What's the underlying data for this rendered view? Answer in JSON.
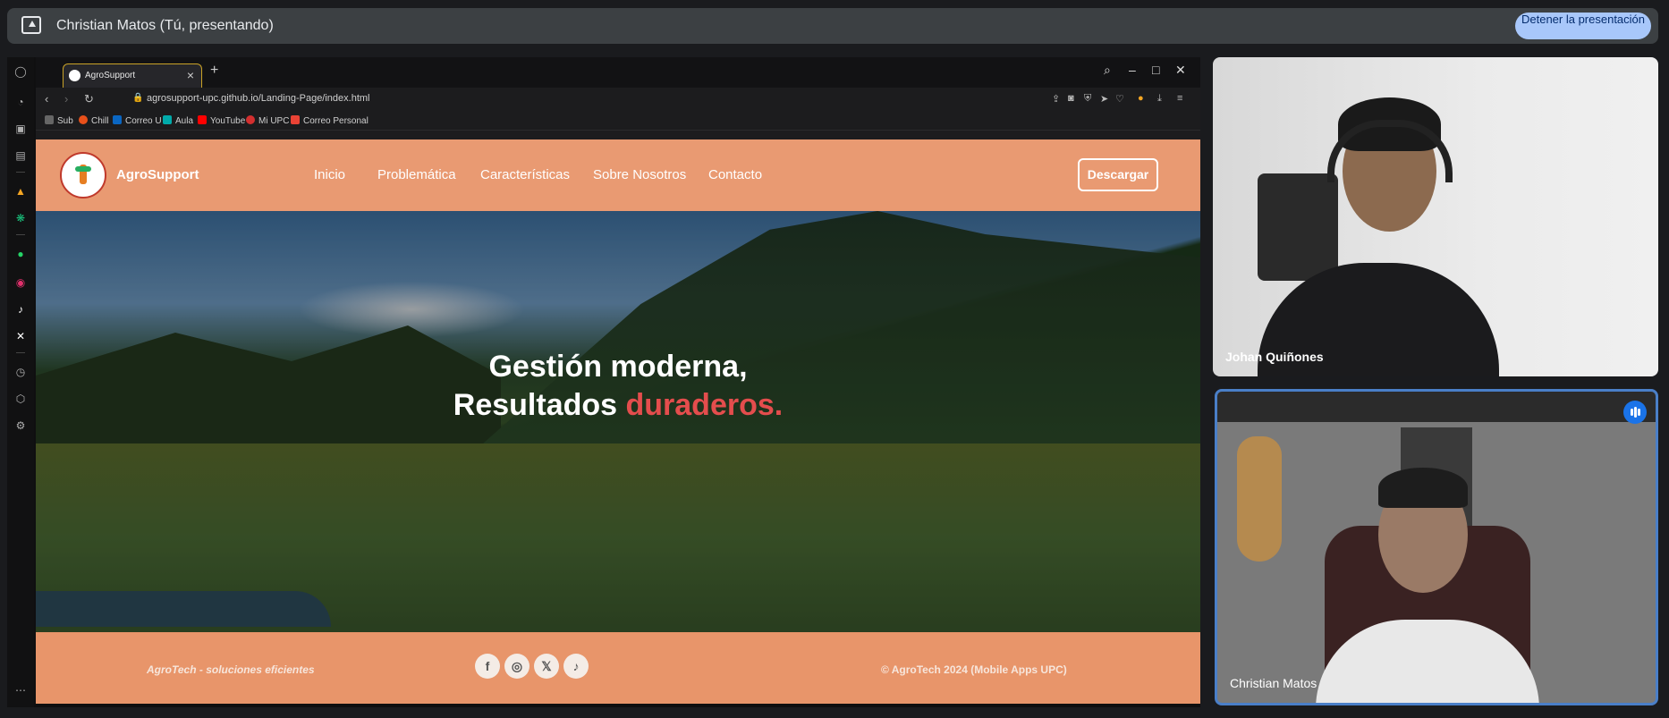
{
  "meet": {
    "presenter_label": "Christian Matos (Tú, presentando)",
    "stop_button": "Detener la presentación"
  },
  "browser": {
    "tab_title": "AgroSupport",
    "url": "agrosupport-upc.github.io/Landing-Page/index.html",
    "bookmarks": [
      "Sub",
      "Chill",
      "Correo U",
      "Aula",
      "YouTube",
      "Mi UPC",
      "Correo Personal"
    ]
  },
  "site": {
    "brand": "AgroSupport",
    "nav": [
      "Inicio",
      "Problemática",
      "Características",
      "Sobre Nosotros",
      "Contacto"
    ],
    "download_button": "Descargar",
    "hero_line1": "Gestión moderna,",
    "hero_line2_start": "Resultados ",
    "hero_line2_accent": "duraderos.",
    "footer_left": "AgroTech - soluciones eficientes",
    "footer_right": "© AgroTech 2024 (Mobile Apps UPC)"
  },
  "participants": {
    "johan": "Johan Quiñones",
    "christian": "Christian Matos"
  },
  "colors": {
    "site_orange": "#e99a72",
    "hero_accent": "#e44d4d",
    "meet_stop": "#a8c7fa",
    "active_speaker": "#4a7fc8"
  }
}
